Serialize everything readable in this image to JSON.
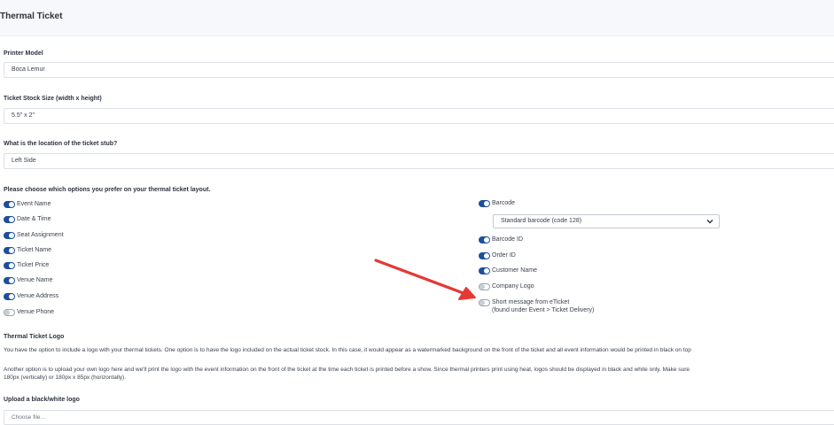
{
  "header": {
    "title": "Thermal Ticket"
  },
  "printer_model": {
    "label": "Printer Model",
    "value": "Boca Lemur"
  },
  "stock_size": {
    "label": "Ticket Stock Size (width x height)",
    "value": "5.5\" x 2\""
  },
  "stub_location": {
    "label": "What is the location of the ticket stub?",
    "value": "Left Side"
  },
  "options": {
    "title": "Please choose which options you prefer on your thermal ticket layout.",
    "left": [
      {
        "label": "Event Name",
        "enabled": true
      },
      {
        "label": "Date & Time",
        "enabled": true
      },
      {
        "label": "Seat Assignment",
        "enabled": true
      },
      {
        "label": "Ticket Name",
        "enabled": true
      },
      {
        "label": "Ticket Price",
        "enabled": true
      },
      {
        "label": "Venue Name",
        "enabled": true
      },
      {
        "label": "Venue Address",
        "enabled": true
      },
      {
        "label": "Venue Phone",
        "enabled": false
      }
    ],
    "right": {
      "barcode": {
        "label": "Barcode",
        "enabled": true
      },
      "barcode_select": {
        "value": "Standard barcode (code 128)"
      },
      "barcode_id": {
        "label": "Barcode ID",
        "enabled": true
      },
      "order_id": {
        "label": "Order ID",
        "enabled": true
      },
      "customer_name": {
        "label": "Customer Name",
        "enabled": true
      },
      "company_logo": {
        "label": "Company Logo",
        "enabled": false
      },
      "short_message": {
        "label": "Short message from eTicket",
        "note": "(found under Event > Ticket Delivery)",
        "enabled": false
      }
    }
  },
  "logo_section": {
    "title": "Thermal Ticket Logo",
    "para1": "You have the option to include a logo with your thermal tickets. One option is to have the logo included on the actual ticket stock. In this case, it would appear as a watermarked background on the front of the ticket and all event information would be printed in black on top",
    "para2_line1": "Another option is to upload your own logo here and we'll print the logo with the event information on the front of the ticket at the time each ticket is printed before a show. Since thermal printers print using heat, logos should be displayed in black and white only. Make sure",
    "para2_line2": "180px (vertically) or 180px x 85px (horizontally)."
  },
  "upload": {
    "label": "Upload a black/white logo",
    "placeholder": "Choose file..."
  },
  "colors": {
    "accent": "#1c4f9c",
    "annotation_arrow": "#e53935"
  }
}
